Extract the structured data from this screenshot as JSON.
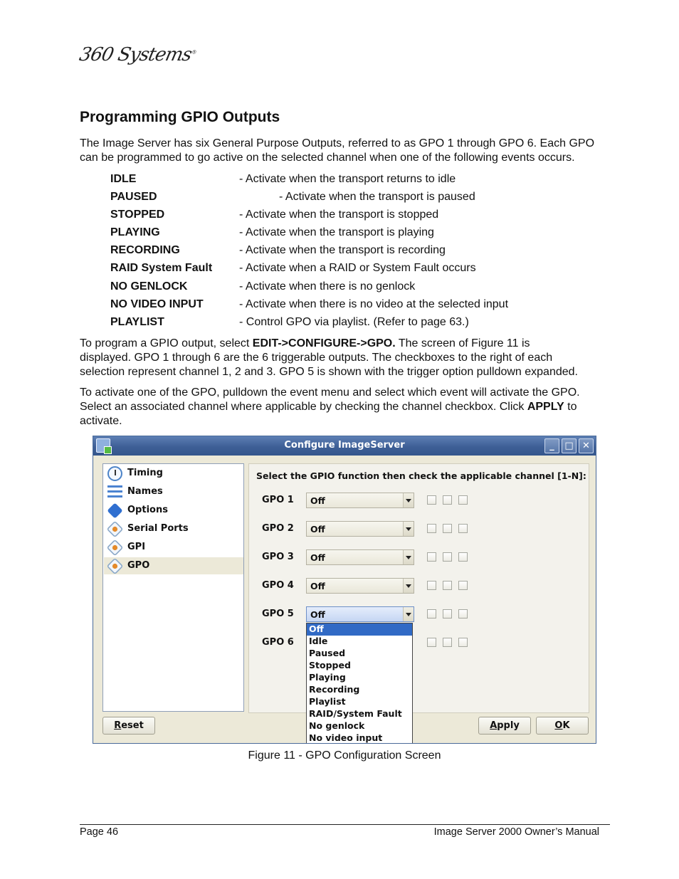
{
  "logo": {
    "text": "360 Systems",
    "mark": "®"
  },
  "heading": "Programming GPIO Outputs",
  "intro": {
    "line1": "The Image Server has six General Purpose Outputs, referred to as GPO 1 through GPO 6.  Each GPO",
    "line2": "can be programmed to go active on the selected channel when one of the following events occurs."
  },
  "events": [
    {
      "name": "IDLE",
      "desc": "- Activate when the transport returns to idle"
    },
    {
      "name": "PAUSED",
      "desc": "- Activate when the transport is paused"
    },
    {
      "name": "STOPPED",
      "desc": "- Activate when the transport is stopped"
    },
    {
      "name": "PLAYING",
      "desc": "- Activate when the transport is playing"
    },
    {
      "name": "RECORDING",
      "desc": "- Activate when the transport is recording"
    },
    {
      "name": "RAID System Fault",
      "desc": "- Activate when a RAID or System Fault occurs"
    },
    {
      "name": "NO GENLOCK",
      "desc": "- Activate when there is no genlock"
    },
    {
      "name": "NO VIDEO INPUT",
      "desc": "- Activate when there is no video at the selected input"
    },
    {
      "name": "PLAYLIST",
      "desc": "- Control GPO via playlist. (Refer to page 63.)"
    }
  ],
  "program_para": {
    "t1": "To program a GPIO output, select ",
    "menu_path": "EDIT->CONFIGURE->GPO.",
    "t2": " The screen of Figure 11 is",
    "line2": "displayed. GPO 1 through 6 are the 6 triggerable outputs. The checkboxes to the right of each",
    "line3": "selection represent channel 1, 2 and 3. GPO 5 is shown with the trigger option pulldown expanded."
  },
  "activate_para": {
    "line1": "To activate one of the GPO, pulldown the event menu and select which event will activate the GPO.",
    "t2": "Select an associated channel where applicable by checking the channel checkbox. Click ",
    "apply_word": "APPLY",
    "t3": " to",
    "line3": "activate."
  },
  "window": {
    "title": "Configure ImageServer",
    "title_buttons": [
      "_",
      "□",
      "✕"
    ],
    "nav_items": [
      {
        "label": "Timing",
        "icon": "clock-icon",
        "selected": false
      },
      {
        "label": "Names",
        "icon": "list-icon",
        "selected": false
      },
      {
        "label": "Options",
        "icon": "puzzle-icon",
        "selected": false
      },
      {
        "label": "Serial Ports",
        "icon": "port-icon",
        "selected": false
      },
      {
        "label": "GPI",
        "icon": "port-icon",
        "selected": false
      },
      {
        "label": "GPO",
        "icon": "port-icon",
        "selected": true
      }
    ],
    "instruction": "Select the GPIO function then check the applicable channel [1-N]:",
    "gpos": [
      {
        "label": "GPO 1",
        "value": "Off"
      },
      {
        "label": "GPO 2",
        "value": "Off"
      },
      {
        "label": "GPO 3",
        "value": "Off"
      },
      {
        "label": "GPO 4",
        "value": "Off"
      },
      {
        "label": "GPO 5",
        "value": "Off"
      },
      {
        "label": "GPO 6",
        "value": ""
      }
    ],
    "open_dropdown_options": [
      "Off",
      "Idle",
      "Paused",
      "Stopped",
      "Playing",
      "Recording",
      "Playlist",
      "RAID/System Fault",
      "No genlock",
      "No video input"
    ],
    "buttons": {
      "reset_key": "R",
      "reset_rest": "eset",
      "apply_key": "A",
      "apply_rest": "pply",
      "ok_key": "O",
      "ok_rest": "K"
    }
  },
  "caption": "Figure 11 - GPO Configuration Screen",
  "footer": {
    "left": "Page 46",
    "right": "Image Server 2000 Owner’s Manual"
  }
}
